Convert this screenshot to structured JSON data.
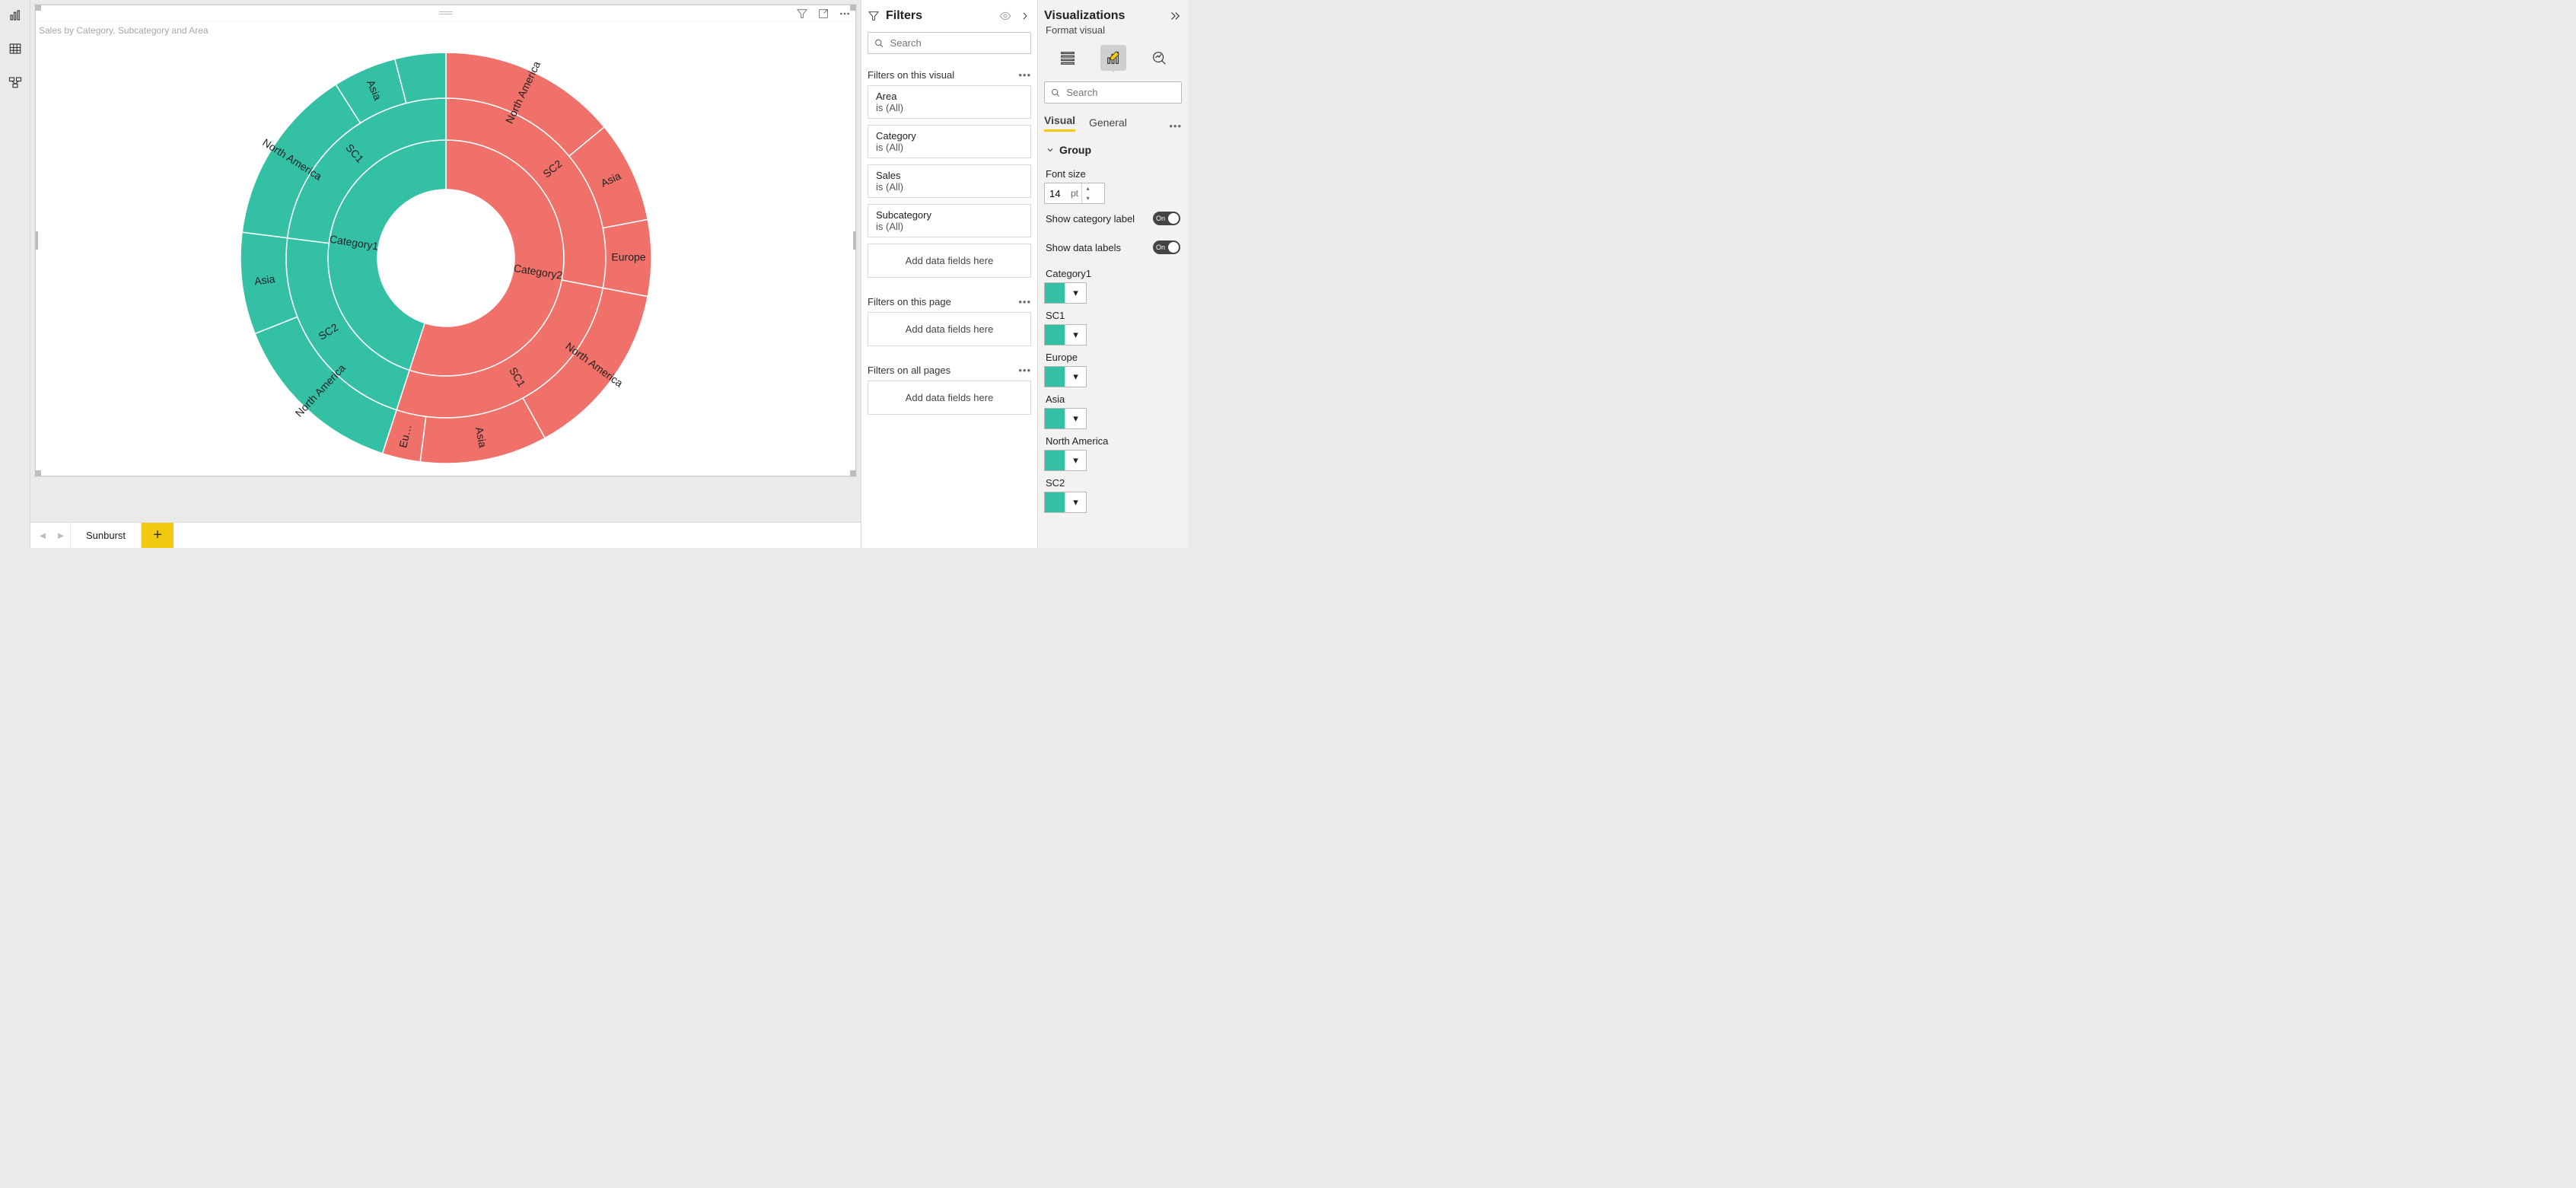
{
  "left_rail": {
    "items": [
      "report-view",
      "data-view",
      "model-view"
    ]
  },
  "canvas": {
    "title": "Sales by Category, Subcategory and Area"
  },
  "page_tabs": {
    "active": "Sunburst"
  },
  "filters": {
    "title": "Filters",
    "search_placeholder": "Search",
    "sections": {
      "visual": {
        "label": "Filters on this visual",
        "cards": [
          {
            "field": "Area",
            "value": "is (All)"
          },
          {
            "field": "Category",
            "value": "is (All)"
          },
          {
            "field": "Sales",
            "value": "is (All)"
          },
          {
            "field": "Subcategory",
            "value": "is (All)"
          }
        ],
        "drop": "Add data fields here"
      },
      "page": {
        "label": "Filters on this page",
        "drop": "Add data fields here"
      },
      "all": {
        "label": "Filters on all pages",
        "drop": "Add data fields here"
      }
    }
  },
  "vis": {
    "title": "Visualizations",
    "subtitle": "Format visual",
    "search_placeholder": "Search",
    "tabs": {
      "visual": "Visual",
      "general": "General"
    },
    "group": "Group",
    "font_label": "Font size",
    "font_value": "14",
    "font_unit": "pt",
    "toggles": {
      "category": {
        "label": "Show category label",
        "value": "On"
      },
      "data": {
        "label": "Show data labels",
        "value": "On"
      }
    },
    "colors": [
      {
        "label": "Category1",
        "hex": "#34c0a5"
      },
      {
        "label": "SC1",
        "hex": "#34c0a5"
      },
      {
        "label": "Europe",
        "hex": "#34c0a5"
      },
      {
        "label": "Asia",
        "hex": "#34c0a5"
      },
      {
        "label": "North America",
        "hex": "#34c0a5"
      },
      {
        "label": "SC2",
        "hex": "#34c0a5"
      }
    ]
  },
  "chart_data": {
    "type": "sunburst",
    "title": "Sales by Category, Subcategory and Area",
    "levels": [
      "Category",
      "Subcategory",
      "Area"
    ],
    "colors": {
      "Category1": "#34c0a5",
      "Category2": "#f0706a"
    },
    "tree": [
      {
        "name": "Category2",
        "color": "#f0706a",
        "value": 55,
        "children": [
          {
            "name": "SC2",
            "value": 28,
            "children": [
              {
                "name": "North America",
                "value": 14
              },
              {
                "name": "Asia",
                "value": 8
              },
              {
                "name": "Europe",
                "value": 6
              }
            ]
          },
          {
            "name": "SC1",
            "value": 27,
            "children": [
              {
                "name": "North America",
                "value": 14
              },
              {
                "name": "Asia",
                "value": 10
              },
              {
                "name": "Eu…",
                "value": 3
              }
            ]
          }
        ]
      },
      {
        "name": "Category1",
        "color": "#34c0a5",
        "value": 45,
        "children": [
          {
            "name": "SC2",
            "value": 22,
            "children": [
              {
                "name": "North America",
                "value": 14
              },
              {
                "name": "Asia",
                "value": 8
              }
            ]
          },
          {
            "name": "SC1",
            "value": 23,
            "children": [
              {
                "name": "North America",
                "value": 14
              },
              {
                "name": "Asia",
                "value": 5
              },
              {
                "name": "",
                "value": 4
              }
            ]
          }
        ]
      }
    ]
  }
}
